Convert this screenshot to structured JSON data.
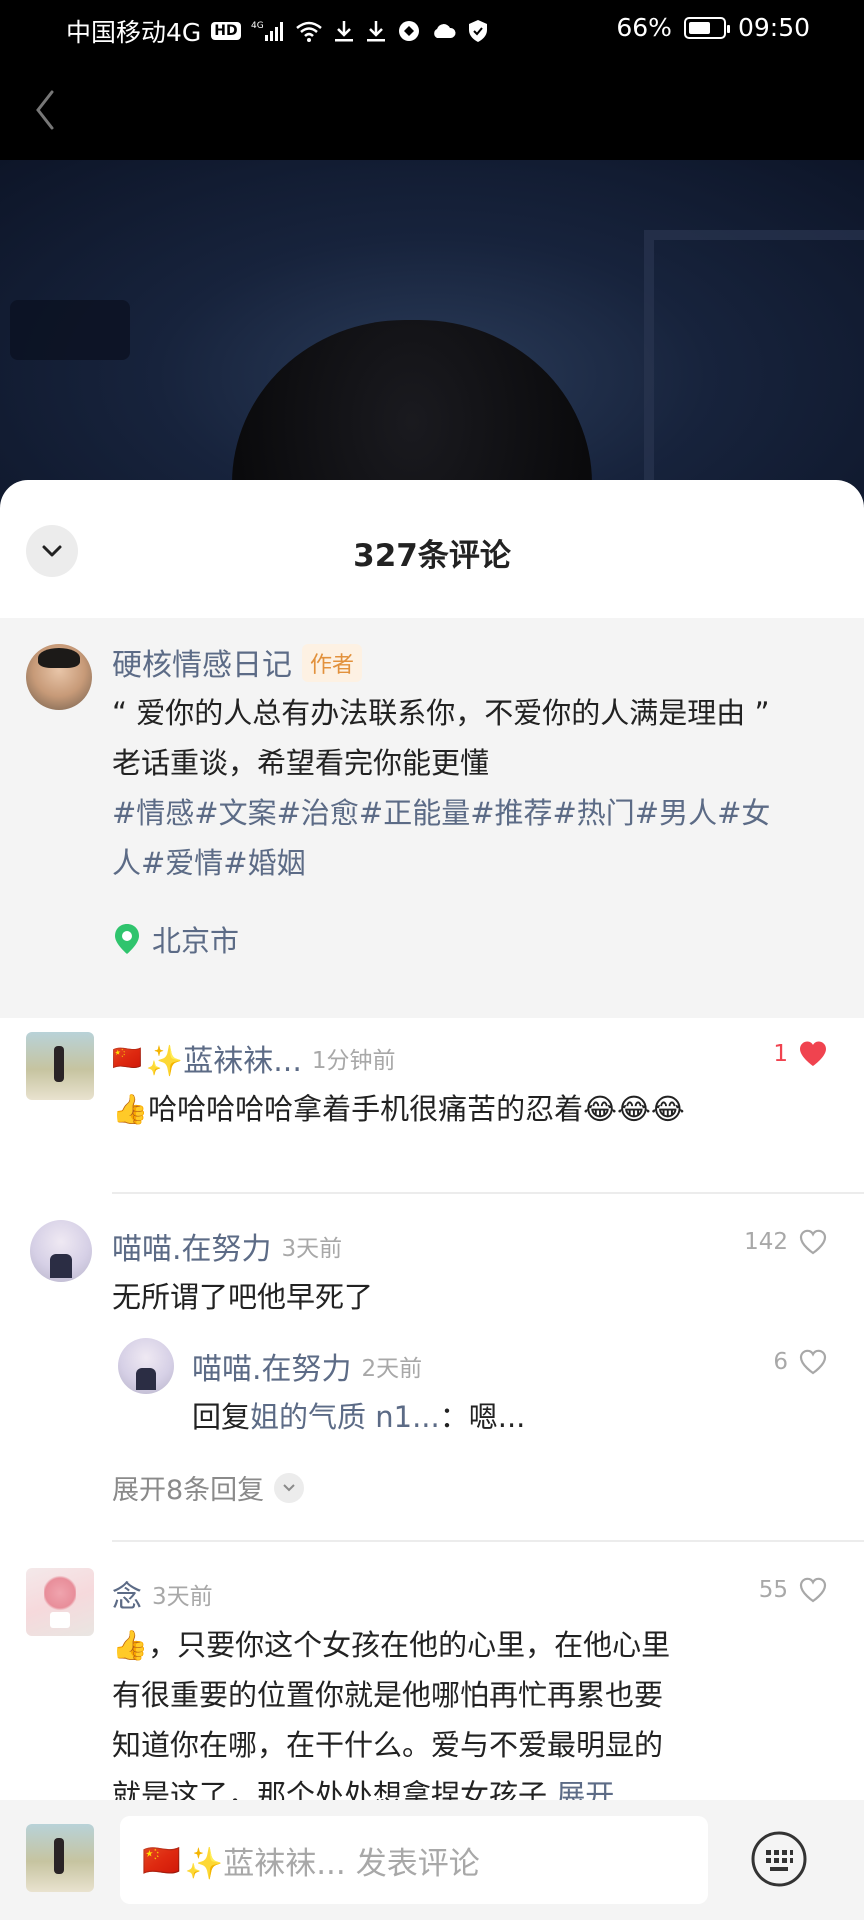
{
  "status_bar": {
    "carrier": "中国移动4G",
    "hd_badge": "HD",
    "net_badge": "4G",
    "battery": "66%",
    "battery_level": 0.66,
    "time": "09:50"
  },
  "sheet": {
    "title": "327条评论"
  },
  "author_post": {
    "name": "硬核情感日记",
    "badge": "作者",
    "line1": "“ 爱你的人总有办法联系你，不爱你的人满是理由 ”",
    "line2": "老话重谈，希望看完你能更懂",
    "tags_line1": "#情感#文案#治愈#正能量#推荐#热门#男人#女",
    "tags_line2": "人#爱情#婚姻",
    "location": "北京市"
  },
  "comments": [
    {
      "name": "✨蓝袜袜...",
      "flag": "🇨🇳",
      "time": "1分钟前",
      "text_emoji_lead": "👍",
      "text": "哈哈哈哈哈拿着手机很痛苦的忍着😂😂😂",
      "likes": "1",
      "liked": true
    },
    {
      "name": "喵喵.在努力",
      "time": "3天前",
      "text": "无所谓了吧他早死了",
      "likes": "142",
      "liked": false,
      "reply": {
        "name": "喵喵.在努力",
        "time": "2天前",
        "prefix": "回复",
        "target": "姐的气质 n1...",
        "text": "：嗯...",
        "likes": "6"
      },
      "expand_label": "展开8条回复"
    },
    {
      "name": "念",
      "time": "3天前",
      "text_emoji_lead": "👍",
      "line1": "，只要你这个女孩在他的心里，在他心里",
      "line2": "有很重要的位置你就是他哪怕再忙再累也要",
      "line3": "知道你在哪，在干什么。爱与不爱最明显的",
      "line4": "就是这了，那个处处想拿捏女孩子",
      "more": "展开",
      "likes": "55",
      "liked": false
    }
  ],
  "bottom_bar": {
    "flag": "🇨🇳",
    "user": "✨蓝袜袜...",
    "placeholder": "发表评论"
  },
  "colors": {
    "link": "#5c6b86",
    "heart": "#f0434f",
    "badge_bg": "#fdf1e3",
    "badge_text": "#e2913c"
  }
}
